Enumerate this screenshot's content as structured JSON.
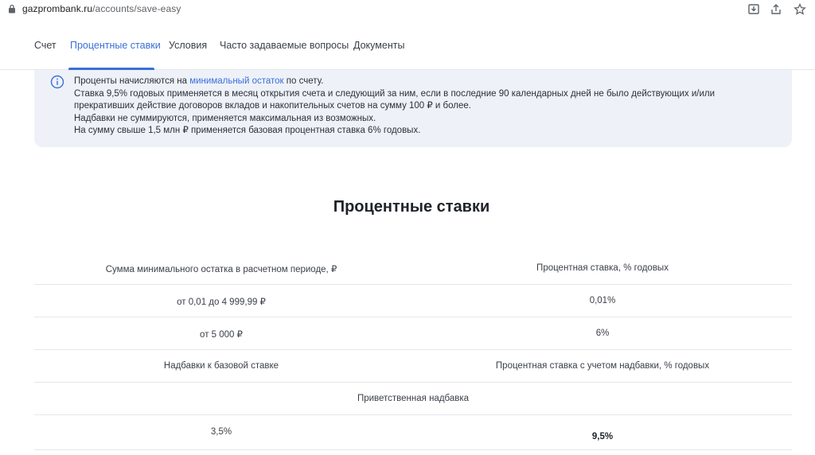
{
  "browser": {
    "url_host": "gazprombank.ru",
    "url_path": "/accounts/save-easy"
  },
  "tabs": [
    {
      "label": "Счет"
    },
    {
      "label": "Процентные ставки"
    },
    {
      "label": "Условия"
    },
    {
      "label": "Часто задаваемые вопросы"
    },
    {
      "label": "Документы"
    }
  ],
  "info": {
    "line1_pre": "Проценты начисляются на ",
    "line1_link": "минимальный остаток",
    "line1_post": " по счету.",
    "line2": "Ставка 9,5% годовых применяется в месяц открытия счета и следующий за ним, если в последние 90 календарных дней не было действующих и/или прекративших действие договоров вкладов и накопительных счетов на сумму 100 ₽ и более.",
    "line3": "Надбавки не суммируются, применяется максимальная из возможных.",
    "line4": "На сумму свыше 1,5 млн ₽ применяется базовая процентная ставка 6% годовых."
  },
  "section_title": "Процентные ставки",
  "table": {
    "header": {
      "left": "Сумма минимального остатка в расчетном периоде, ₽",
      "right": "Процентная ставка, % годовых"
    },
    "rows": [
      {
        "left": "от 0,01 до 4 999,99 ₽",
        "right": "0,01%"
      },
      {
        "left": "от 5 000 ₽",
        "right": "6%"
      }
    ],
    "subheader": {
      "left": "Надбавки к базовой ставке",
      "right": "Процентная ставка с учетом надбавки, % годовых"
    },
    "group_label": "Приветственная надбавка",
    "bonus_row": {
      "left": "3,5%",
      "right": "9,5%"
    }
  }
}
